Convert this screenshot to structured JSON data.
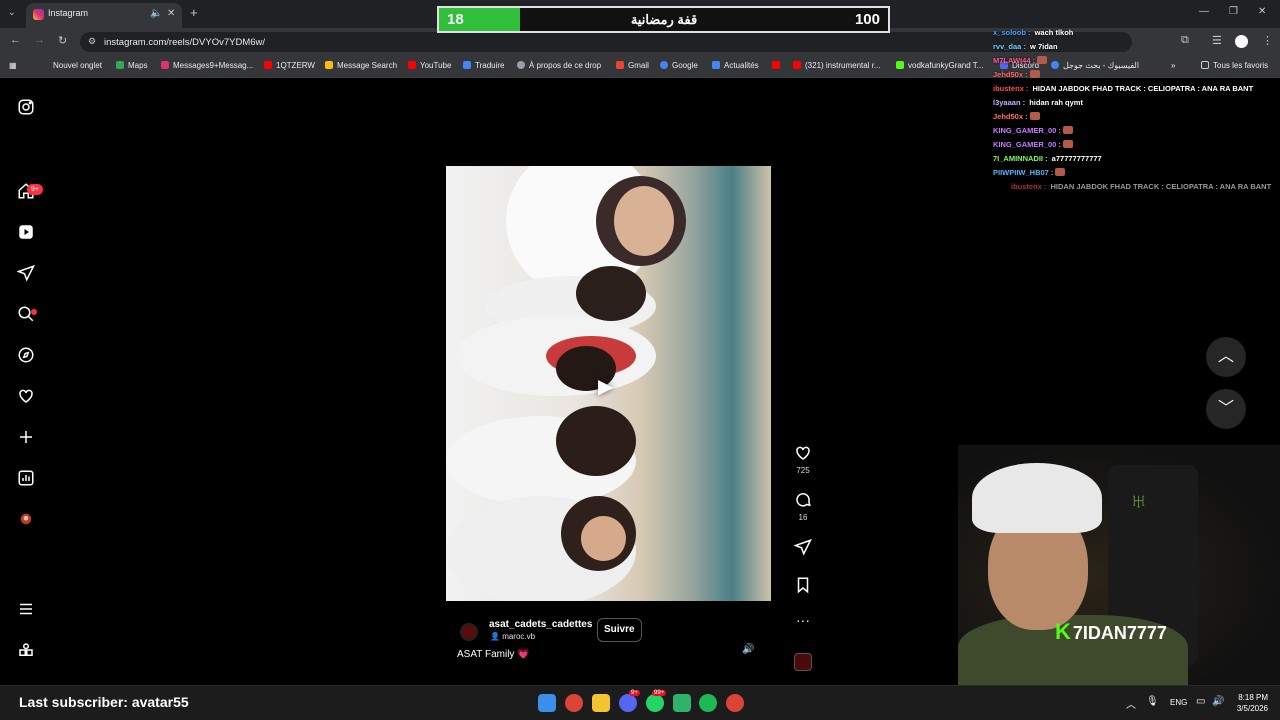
{
  "browser": {
    "tab_title": "Instagram",
    "url": "instagram.com/reels/DVYOv7YDM6w/",
    "bookmarks": [
      "Nouvel onglet",
      "Maps",
      "Messages9+Messag...",
      "1QTZERW",
      "Message Search",
      "YouTube",
      "Traduire",
      "À propos de ce drop",
      "Gmail",
      "Google",
      "Actualités",
      "(321) instrumental r...",
      "vodkafunkyGrand T...",
      "Discord",
      "الفيسبوك - بحث جوجل"
    ],
    "all_bookmarks": "Tous les favoris"
  },
  "scorebar": {
    "current": "18",
    "max": "100",
    "title": "قفة رمضانية",
    "progress": 0.18
  },
  "sidebar": {
    "notif_badge": "9+"
  },
  "reel": {
    "author": "asat_cadets_cadettes",
    "audio": "maroc.vb",
    "follow_label": "Suivre",
    "caption": "ASAT Family 💗",
    "likes": "725",
    "comments": "16"
  },
  "chat": [
    {
      "user": "x_soloob",
      "msg": "wach tlkoh",
      "color": "#3ea6ff"
    },
    {
      "user": "rvv_daa",
      "msg": "w 7idan",
      "color": "#6ad0ff"
    },
    {
      "user": "M7LAWI44",
      "msg": "",
      "color": "#ff5c8a"
    },
    {
      "user": "Jehd50x",
      "msg": "",
      "color": "#ff6b6b"
    },
    {
      "user": "ibustenx",
      "msg": "HIDAN JABDOK FHAD TRACK : CELIOPATRA : ANA RA BANT",
      "color": "#ff4d4d"
    },
    {
      "user": "l3yaaan",
      "msg": "hidan rah qymt",
      "color": "#b9b9ff"
    },
    {
      "user": "Jehd50x",
      "msg": "",
      "color": "#ff6b6b"
    },
    {
      "user": "KING_GAMER_00",
      "msg": "",
      "color": "#c77dff"
    },
    {
      "user": "KING_GAMER_00",
      "msg": "",
      "color": "#c77dff"
    },
    {
      "user": "7I_AMINNADII",
      "msg": "a77777777777",
      "color": "#7cff5c"
    },
    {
      "user": "PIIWPIIW_HB07",
      "msg": "",
      "color": "#4db8ff"
    },
    {
      "user": "ibustenx",
      "msg": "HIDAN JABDOK FHAD TRACK : CELIOPATRA : ANA RA BANT",
      "color": "#a33"
    }
  ],
  "stream": {
    "streamer": "7IDAN7777",
    "last_subscriber": "Last subscriber: avatar55"
  },
  "taskbar": {
    "lang": "ENG",
    "time": "8:18 PM",
    "date": "3/5/2026",
    "badge1": "9+",
    "badge2": "99+"
  }
}
